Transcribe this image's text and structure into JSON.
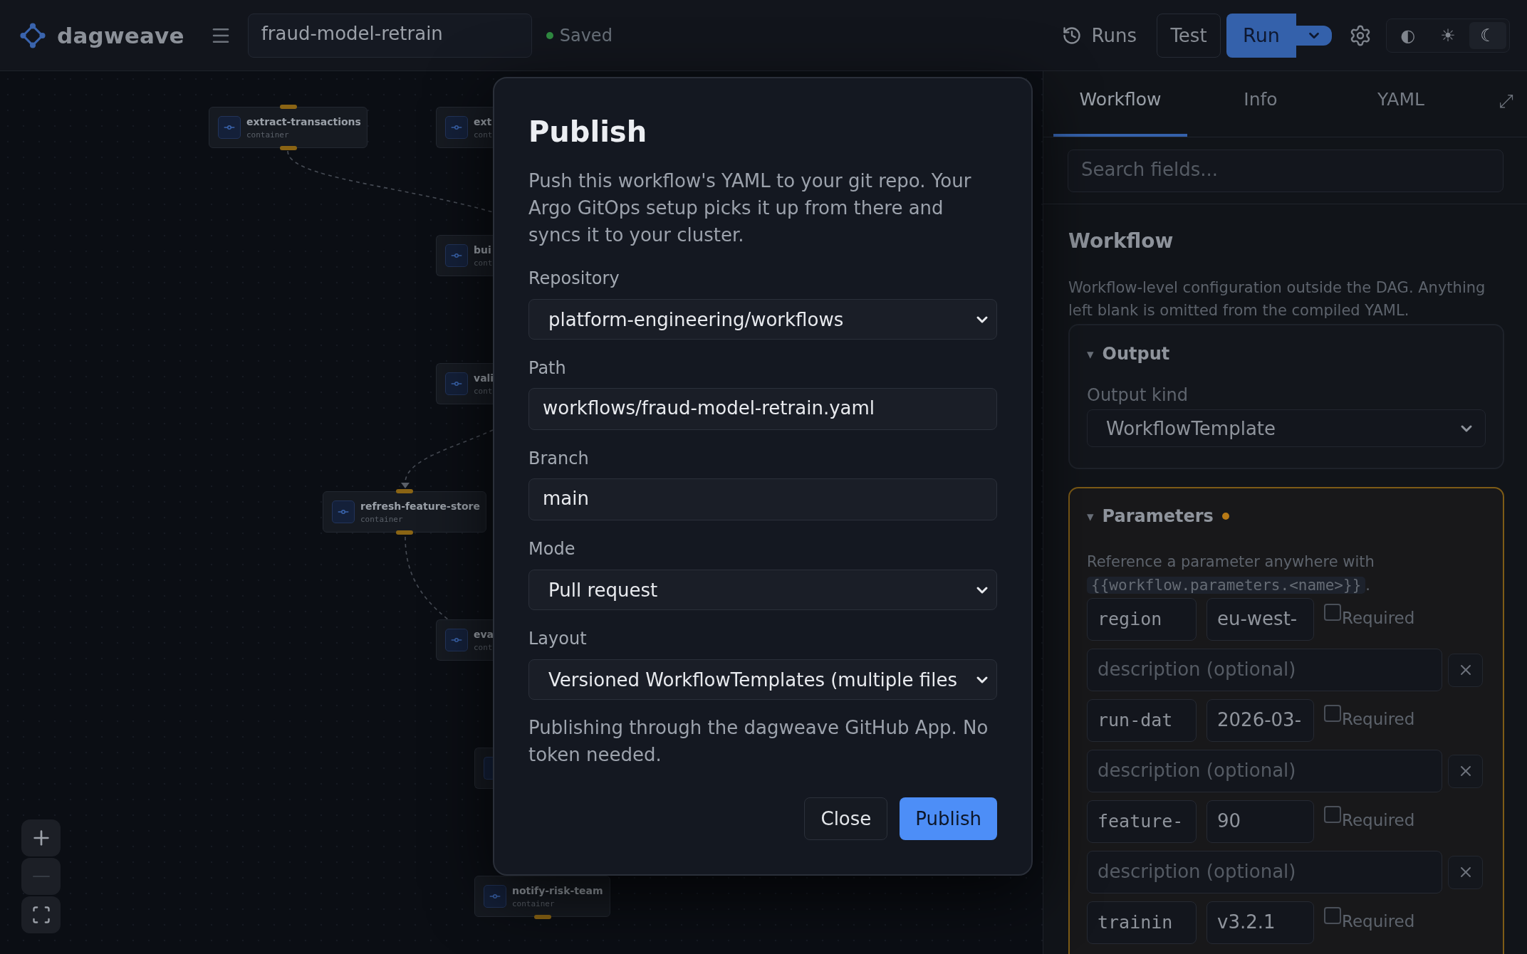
{
  "app_bar": {
    "brand": "dagweave",
    "workflow_name": "fraud-model-retrain",
    "save_status": {
      "kind": "saved",
      "label": "Saved"
    },
    "runs_button": "Runs",
    "test_button": "Test",
    "run_button": "Run",
    "theme_options": [
      {
        "label": "◐",
        "selected": false
      },
      {
        "label": "☀",
        "selected": false
      },
      {
        "label": "☾",
        "selected": true
      }
    ]
  },
  "canvas": {
    "nodes": [
      {
        "name": "extract-transactions",
        "type": "container"
      },
      {
        "name": "ext",
        "type": "cont"
      },
      {
        "name": "bui",
        "type": "cont"
      },
      {
        "name": "vali",
        "type": "cont"
      },
      {
        "name": "refresh-feature-store",
        "type": "container"
      },
      {
        "name": "eva",
        "type": "cont"
      },
      {
        "name": "notify-risk-team",
        "type": "container"
      }
    ],
    "zoom_controls": [
      {
        "kind": "zoom-in",
        "disabled": false
      },
      {
        "kind": "zoom-out",
        "disabled": true
      },
      {
        "kind": "fit",
        "disabled": false
      }
    ]
  },
  "side_panel": {
    "tabs": [
      {
        "label": "Workflow",
        "selected": true
      },
      {
        "label": "Info",
        "selected": false
      },
      {
        "label": "YAML",
        "selected": false
      }
    ],
    "expand_glyph": "⤢",
    "search": {
      "placeholder": "Search fields..."
    },
    "heading": "Workflow",
    "description": "Workflow-level configuration outside the DAG. Anything left blank is omitted from the compiled YAML.",
    "sections": [
      {
        "kind": "output",
        "caret": "▾",
        "title": "Output",
        "expanded": true,
        "modified": false,
        "field_label": "Output kind",
        "field_value": "WorkflowTemplate"
      },
      {
        "kind": "parameters",
        "caret": "▾",
        "title": "Parameters",
        "expanded": true,
        "modified": true,
        "hint": {
          "text": "Reference a parameter anywhere with",
          "code": "{{workflow.parameters.<name>}}",
          "end": "."
        },
        "parameters": [
          {
            "name": "region",
            "value": "eu-west-",
            "required": false,
            "required_label": "Required",
            "description_placeholder": "description (optional)"
          },
          {
            "name": "run-dat",
            "value": "2026-03-",
            "required": false,
            "required_label": "Required",
            "description_placeholder": "description (optional)"
          },
          {
            "name": "feature-",
            "value": "90",
            "required": false,
            "required_label": "Required",
            "description_placeholder": "description (optional)"
          },
          {
            "name": "trainin",
            "value": "v3.2.1",
            "required": false,
            "required_label": "Required"
          }
        ]
      }
    ]
  },
  "publish_dialog": {
    "title": "Publish",
    "description": "Push this workflow's YAML to your git repo. Your Argo GitOps setup picks it up from there and syncs it to your cluster.",
    "fields": [
      {
        "kind": "select",
        "label": "Repository",
        "value": "platform-engineering/workflows"
      },
      {
        "kind": "input",
        "label": "Path",
        "value": "workflows/fraud-model-retrain.yaml"
      },
      {
        "kind": "input",
        "label": "Branch",
        "value": "main"
      },
      {
        "kind": "select",
        "label": "Mode",
        "value": "Pull request"
      },
      {
        "kind": "select",
        "label": "Layout",
        "value": "Versioned WorkflowTemplates (multiple files"
      }
    ],
    "note": "Publishing through the dagweave GitHub App. No token needed.",
    "buttons": [
      {
        "kind": "secondary",
        "label": "Close"
      },
      {
        "kind": "primary",
        "label": "Publish"
      }
    ]
  }
}
